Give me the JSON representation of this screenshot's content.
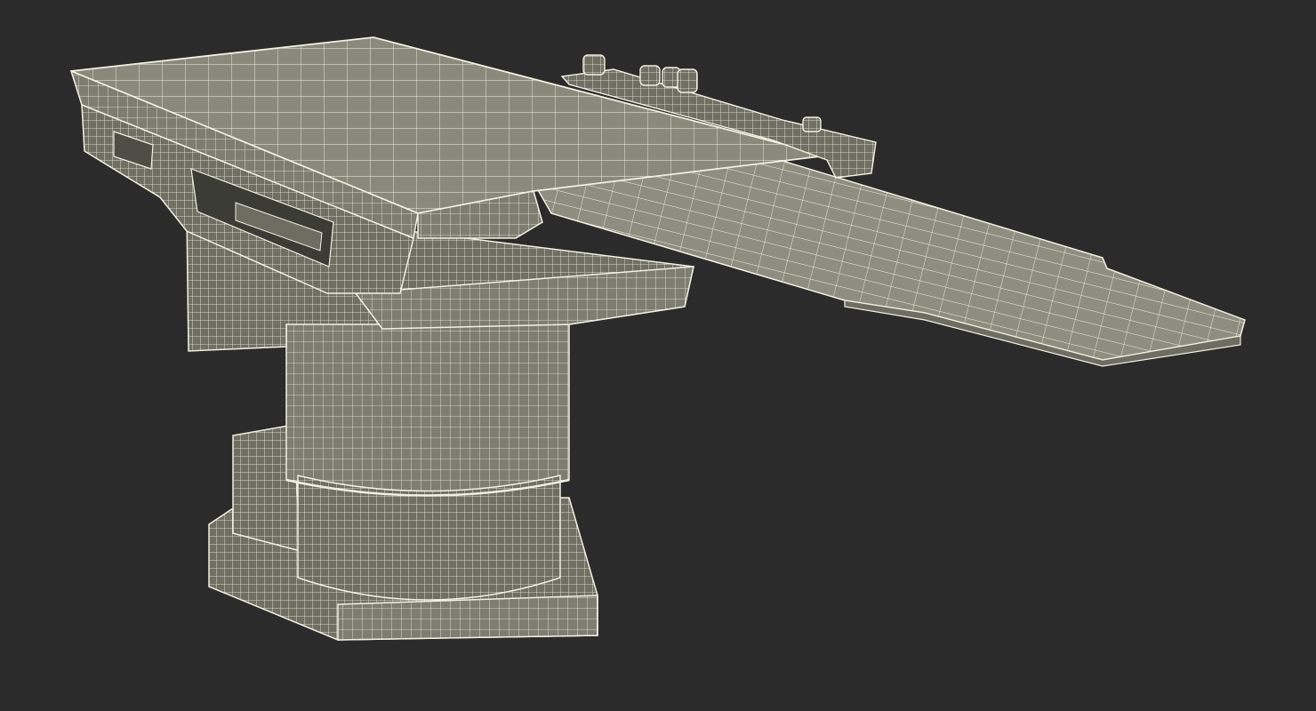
{
  "scene": {
    "background_color": "#2b2b2b",
    "render_mode": "wireframe-on-shaded",
    "surface_color": "#8a8a7c",
    "surface_dark_color": "#6d6d62",
    "wire_color": "#f2f0e2"
  },
  "model": {
    "icon": "surgical-table-icon",
    "parts": [
      "base",
      "column",
      "side-block",
      "tabletop",
      "leg-extension",
      "control-knobs",
      "side-rails"
    ]
  }
}
